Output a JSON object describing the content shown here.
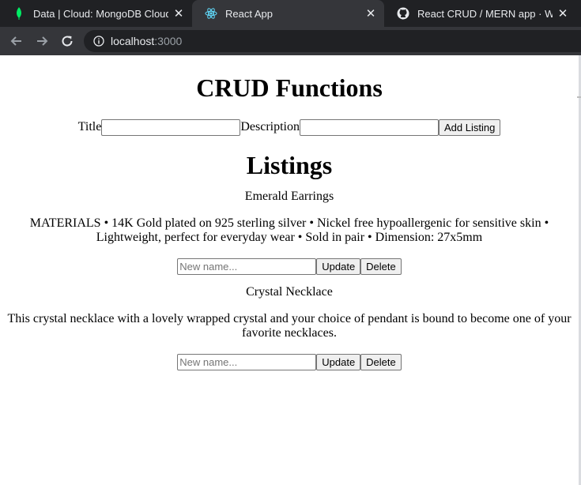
{
  "browser": {
    "tabs": [
      {
        "title": "Data | Cloud: MongoDB Cloud",
        "icon": "mongodb-leaf-icon",
        "close": "✕"
      },
      {
        "title": "React App",
        "icon": "react-icon",
        "close": "✕"
      },
      {
        "title": "React CRUD / MERN app · WebD",
        "icon": "github-icon",
        "close": "✕"
      }
    ],
    "address": {
      "host": "localhost",
      "port": ":3000"
    }
  },
  "page": {
    "title": "CRUD Functions",
    "form": {
      "title_label": "Title",
      "title_value": "",
      "description_label": "Description",
      "description_value": "",
      "add_button": "Add Listing"
    },
    "listings_title": "Listings",
    "listings": [
      {
        "name": "Emerald Earrings",
        "description": "MATERIALS • 14K Gold plated on 925 sterling silver • Nickel free hypoallergenic for sensitive skin • Lightweight, perfect for everyday wear • Sold in pair • Dimension: 27x5mm",
        "new_name_placeholder": "New name...",
        "update_button": "Update",
        "delete_button": "Delete"
      },
      {
        "name": "Crystal Necklace",
        "description": "This crystal necklace with a lovely wrapped crystal and your choice of pendant is bound to become one of your favorite necklaces.",
        "new_name_placeholder": "New name...",
        "update_button": "Update",
        "delete_button": "Delete"
      }
    ]
  },
  "colors": {
    "chrome_dark": "#202124",
    "chrome_active": "#35363a",
    "mongodb_green": "#00ed64",
    "react_blue": "#61dafb"
  }
}
